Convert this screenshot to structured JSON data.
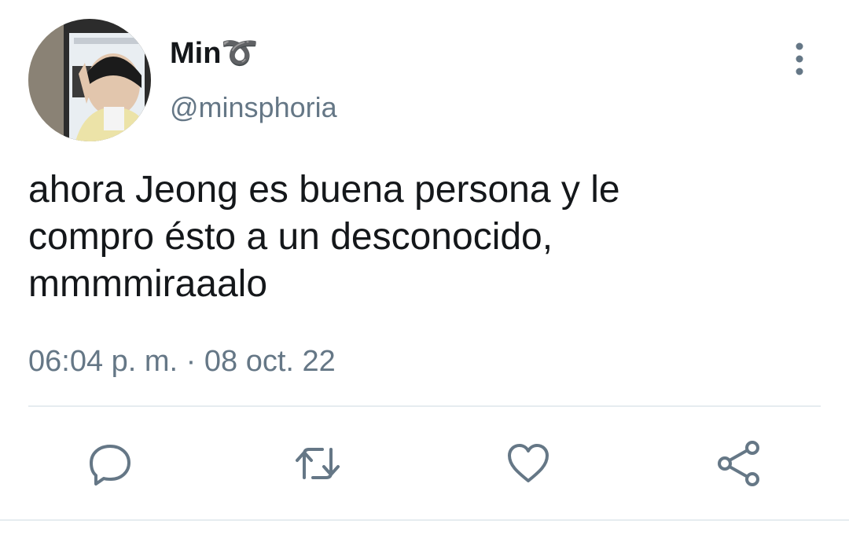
{
  "tweet": {
    "display_name": "Min➰",
    "handle": "@minsphoria",
    "text": "ahora Jeong es buena persona y le\ncompro ésto a un desconocido,\nmmmmiraaalo",
    "timestamp": "06:04 p. m. · 08 oct. 22"
  },
  "header": {
    "avatar_icon": "profile-avatar",
    "menu_icon": "more-vertical-icon"
  },
  "actions": {
    "reply_icon": "reply-icon",
    "retweet_icon": "retweet-icon",
    "like_icon": "heart-icon",
    "share_icon": "share-icon"
  },
  "colors": {
    "text": "#14171a",
    "secondary": "#657786",
    "divider": "#e6ecf0"
  }
}
